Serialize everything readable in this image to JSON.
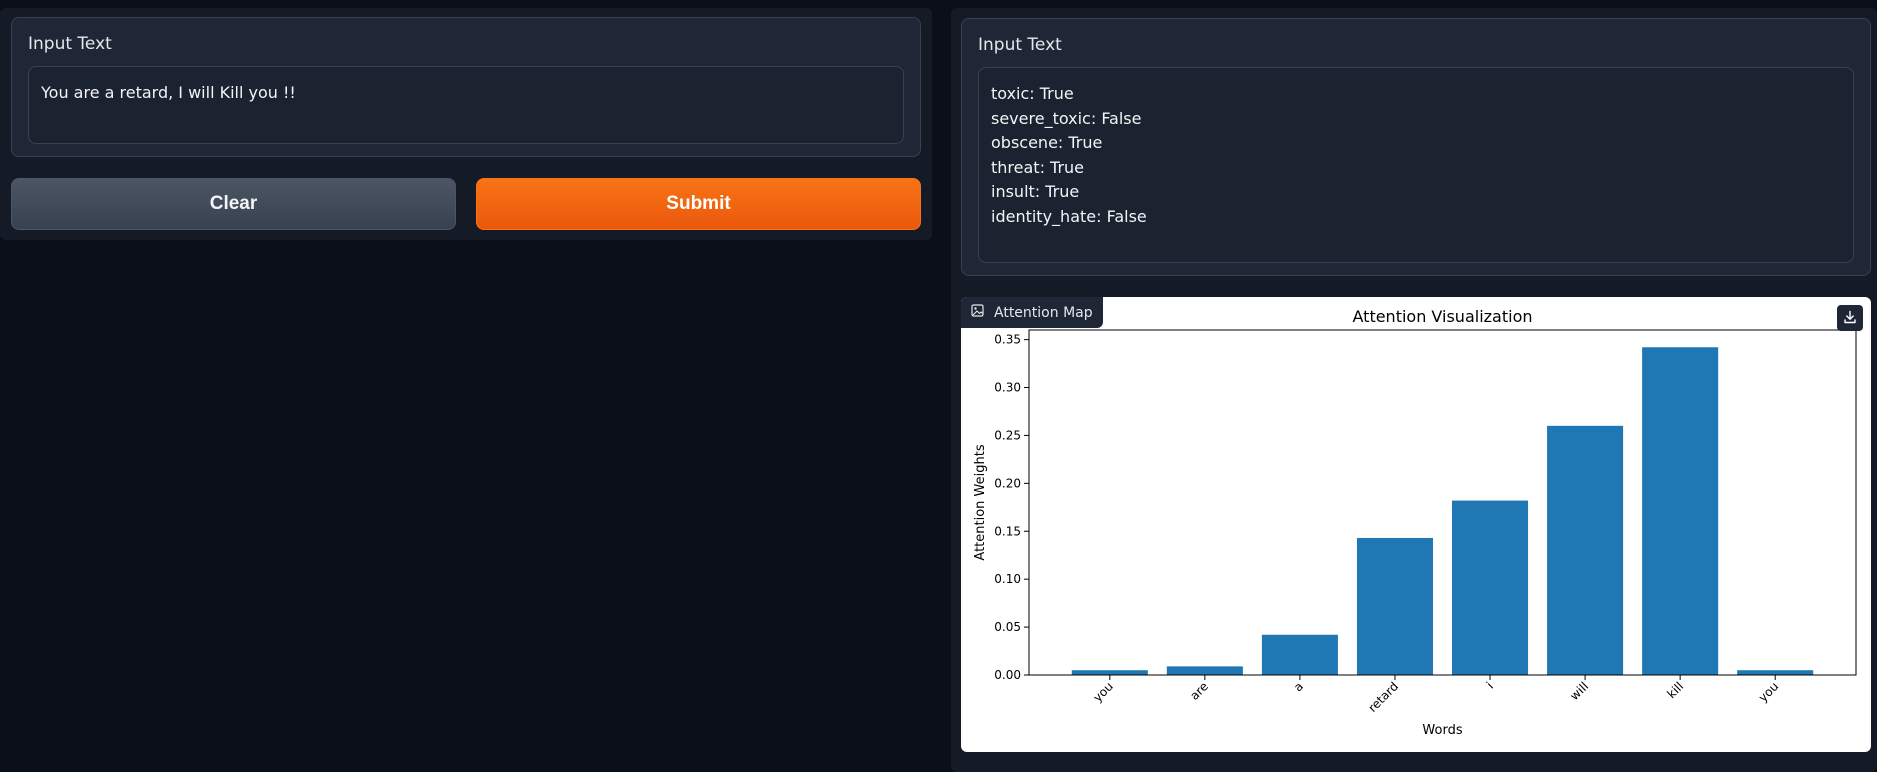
{
  "left": {
    "input_label": "Input Text",
    "input_value": "You are a retard, I will Kill you !!",
    "clear_label": "Clear",
    "submit_label": "Submit"
  },
  "right": {
    "output_label": "Input Text",
    "output_lines": [
      "toxic: True",
      "severe_toxic: False",
      "obscene: True",
      "threat: True",
      "insult: True",
      "identity_hate: False"
    ],
    "plot_tab_label": "Attention Map",
    "icons": {
      "tab": "image-icon",
      "download": "download-icon"
    }
  },
  "colors": {
    "submit": "#f97316",
    "bar": "#1f77b4"
  },
  "chart_data": {
    "type": "bar",
    "title": "Attention Visualization",
    "xlabel": "Words",
    "ylabel": "Attention Weights",
    "categories": [
      "you",
      "are",
      "a",
      "retard",
      "i",
      "will",
      "kill",
      "you"
    ],
    "values": [
      0.005,
      0.009,
      0.042,
      0.143,
      0.182,
      0.26,
      0.342,
      0.005
    ],
    "ylim": [
      0,
      0.36
    ],
    "yticks": [
      0.0,
      0.05,
      0.1,
      0.15,
      0.2,
      0.25,
      0.3,
      0.35
    ],
    "ytick_labels": [
      "0.00",
      "0.05",
      "0.10",
      "0.15",
      "0.20",
      "0.25",
      "0.30",
      "0.35"
    ],
    "grid": false,
    "xtick_rotation": 45
  }
}
